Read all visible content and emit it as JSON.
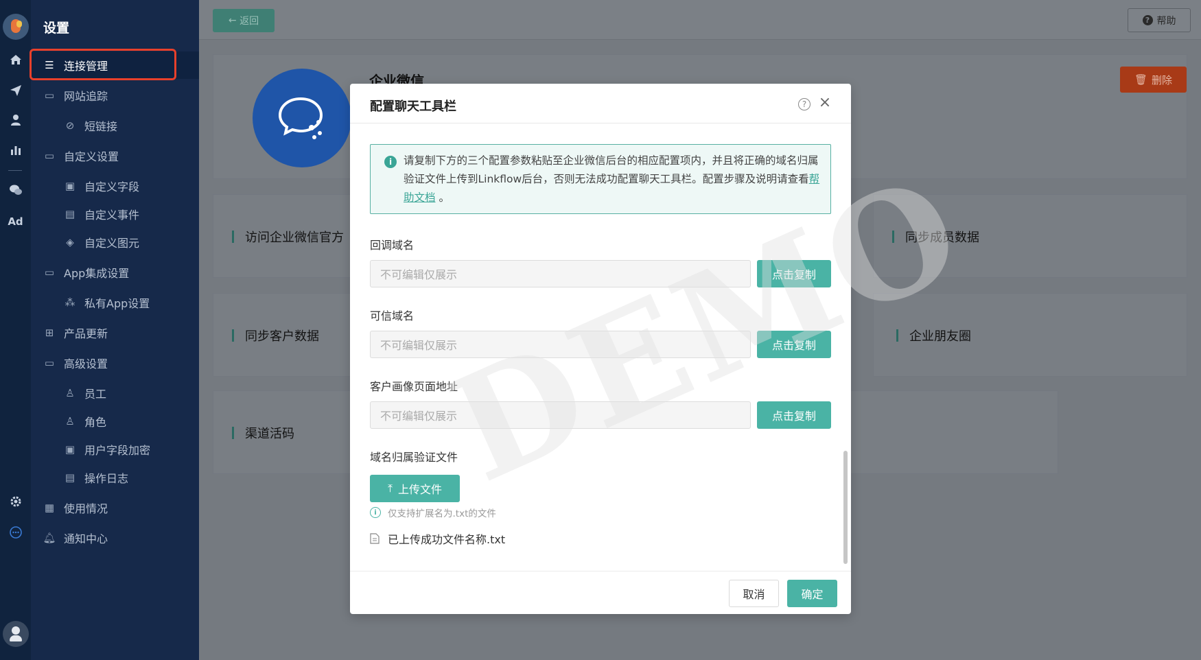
{
  "menu": {
    "title": "设置",
    "items": [
      {
        "label": "连接管理",
        "icon": "sliders-icon",
        "level": 1
      },
      {
        "label": "网站追踪",
        "icon": "folder-icon",
        "level": 1
      },
      {
        "label": "短链接",
        "icon": "link-icon",
        "level": 2
      },
      {
        "label": "自定义设置",
        "icon": "folder-icon",
        "level": 1
      },
      {
        "label": "自定义字段",
        "icon": "field-icon",
        "level": 2
      },
      {
        "label": "自定义事件",
        "icon": "clipboard-icon",
        "level": 2
      },
      {
        "label": "自定义图元",
        "icon": "cube-icon",
        "level": 2
      },
      {
        "label": "App集成设置",
        "icon": "folder-icon",
        "level": 1
      },
      {
        "label": "私有App设置",
        "icon": "apps-icon",
        "level": 2
      },
      {
        "label": "产品更新",
        "icon": "grid-icon",
        "level": 1
      },
      {
        "label": "高级设置",
        "icon": "folder-icon",
        "level": 1
      },
      {
        "label": "员工",
        "icon": "user-icon",
        "level": 2
      },
      {
        "label": "角色",
        "icon": "user-role-icon",
        "level": 2
      },
      {
        "label": "用户字段加密",
        "icon": "encrypt-icon",
        "level": 2
      },
      {
        "label": "操作日志",
        "icon": "log-icon",
        "level": 2
      },
      {
        "label": "使用情况",
        "icon": "usage-icon",
        "level": 1
      },
      {
        "label": "通知中心",
        "icon": "bell-icon",
        "level": 1
      }
    ]
  },
  "topbar": {
    "back_label": "返回",
    "help_label": "帮助"
  },
  "connection": {
    "company": "企业微信",
    "delete_label": "删除",
    "features": [
      "访问企业微信官方",
      "同步成员数据",
      "同步客户数据",
      "企业朋友圈",
      "渠道活码"
    ]
  },
  "dialog": {
    "title": "配置聊天工具栏",
    "notice_text": "请复制下方的三个配置参数粘贴至企业微信后台的相应配置项内，并且将正确的域名归属验证文件上传到Linkflow后台，否则无法成功配置聊天工具栏。配置步骤及说明请查看",
    "notice_link": "帮助文档",
    "notice_tail": " 。",
    "fields": [
      {
        "label": "回调域名",
        "placeholder": "不可编辑仅展示",
        "copy_label": "点击复制"
      },
      {
        "label": "可信域名",
        "placeholder": "不可编辑仅展示",
        "copy_label": "点击复制"
      },
      {
        "label": "客户画像页面地址",
        "placeholder": "不可编辑仅展示",
        "copy_label": "点击复制"
      }
    ],
    "verify_label": "域名归属验证文件",
    "upload_label": "上传文件",
    "upload_hint": "仅支持扩展名为.txt的文件",
    "uploaded_file": "已上传成功文件名称.txt",
    "cancel_label": "取消",
    "ok_label": "确定"
  },
  "watermark": "DEMO",
  "colors": {
    "accent": "#4ab3a5",
    "danger": "#e8402b",
    "sidebar": "#16294a",
    "brand_blue": "#1f55a8"
  }
}
